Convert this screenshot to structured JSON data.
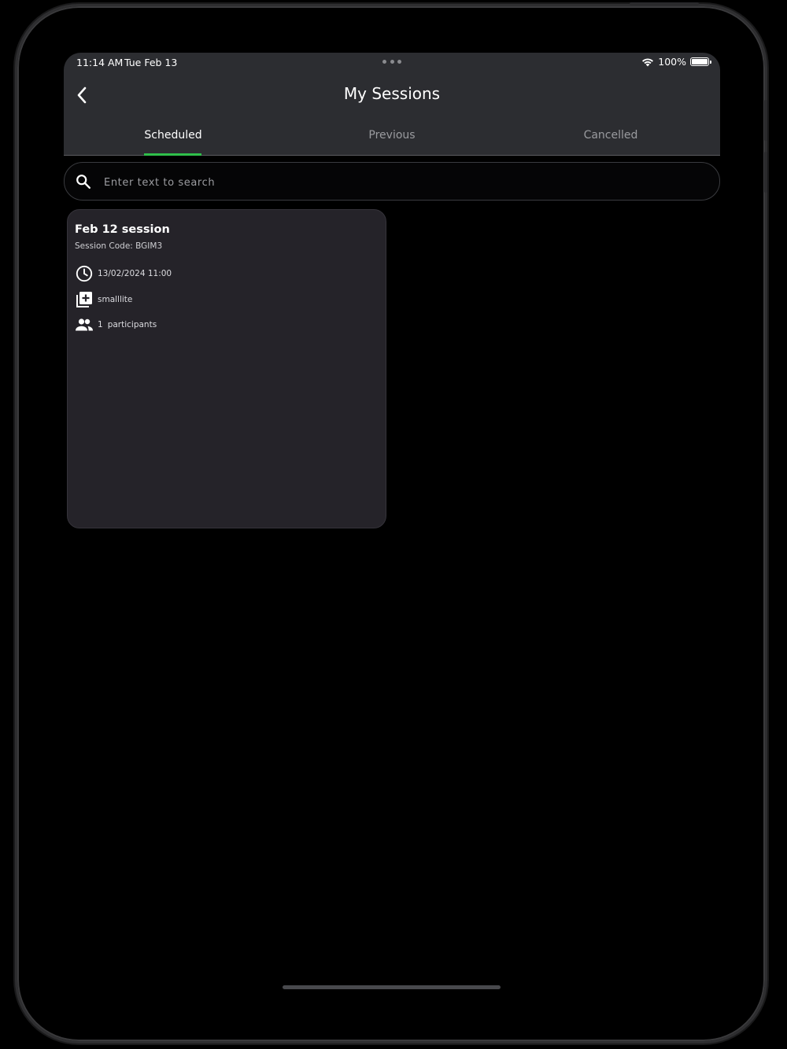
{
  "status_bar": {
    "time": "11:14 AM",
    "date": "Tue Feb 13",
    "battery": "100%"
  },
  "header": {
    "title": "My Sessions"
  },
  "tabs": [
    {
      "label": "Scheduled",
      "active": true
    },
    {
      "label": "Previous",
      "active": false
    },
    {
      "label": "Cancelled",
      "active": false
    }
  ],
  "search": {
    "placeholder": "Enter text to search",
    "value": ""
  },
  "sessions": [
    {
      "title": "Feb 12 session",
      "code": "Session Code: BGIM3",
      "datetime": "13/02/2024 11:00",
      "package": "smalllite",
      "participants_count": "1",
      "participants_label": "participants"
    }
  ],
  "colors": {
    "accent": "#2fbf4a",
    "header_bg": "#2c2d31",
    "card_bg": "#252329"
  },
  "icons": {
    "back": "chevron-left-icon",
    "search": "search-icon",
    "clock": "clock-icon",
    "package": "library-add-icon",
    "participants": "people-icon",
    "wifi": "wifi-icon",
    "battery": "battery-icon"
  }
}
